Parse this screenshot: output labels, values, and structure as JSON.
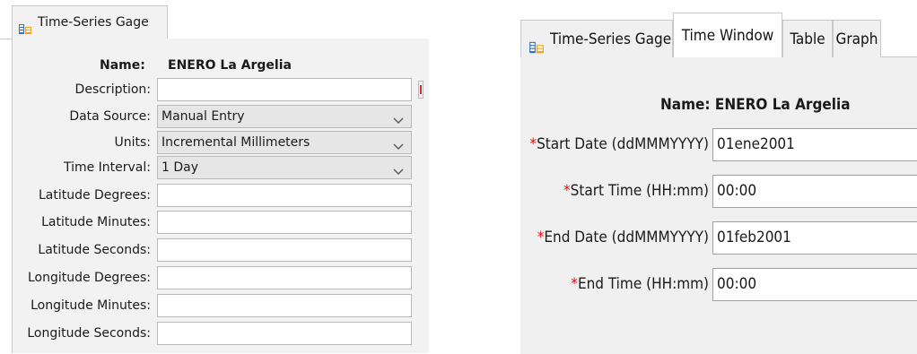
{
  "left": {
    "tab_label": "Time-Series Gage",
    "name_label": "Name:",
    "name_value": "ENERO La Argelia",
    "fields": [
      {
        "label": "Description:",
        "value": ""
      },
      {
        "label": "Data Source:",
        "value": "Manual Entry"
      },
      {
        "label": "Units:",
        "value": "Incremental Millimeters"
      },
      {
        "label": "Time Interval:",
        "value": "1 Day"
      },
      {
        "label": "Latitude Degrees:",
        "value": ""
      },
      {
        "label": "Latitude Minutes:",
        "value": ""
      },
      {
        "label": "Latitude Seconds:",
        "value": ""
      },
      {
        "label": "Longitude Degrees:",
        "value": ""
      },
      {
        "label": "Longitude Minutes:",
        "value": ""
      },
      {
        "label": "Longitude Seconds:",
        "value": ""
      }
    ]
  },
  "right": {
    "tabs": [
      "Time-Series Gage",
      "Time Window",
      "Table",
      "Graph"
    ],
    "selected_tab": "Time Window",
    "name_label": "Name:",
    "name_value": "ENERO La Argelia",
    "required_marker": "*",
    "fields": [
      {
        "label": "Start Date (ddMMMYYYY)",
        "value": "01ene2001"
      },
      {
        "label": "Start Time (HH:mm)",
        "value": "00:00"
      },
      {
        "label": "End Date (ddMMMYYYY)",
        "value": "01feb2001"
      },
      {
        "label": "End Time (HH:mm)",
        "value": "00:00"
      }
    ]
  },
  "colors": {
    "required": "#dd1111",
    "panel_bg": "#f2f2f2",
    "field_border": "#b9b9b9"
  },
  "icons": {
    "gage": "gage-icon",
    "dropdown": "chevron-down-icon"
  }
}
